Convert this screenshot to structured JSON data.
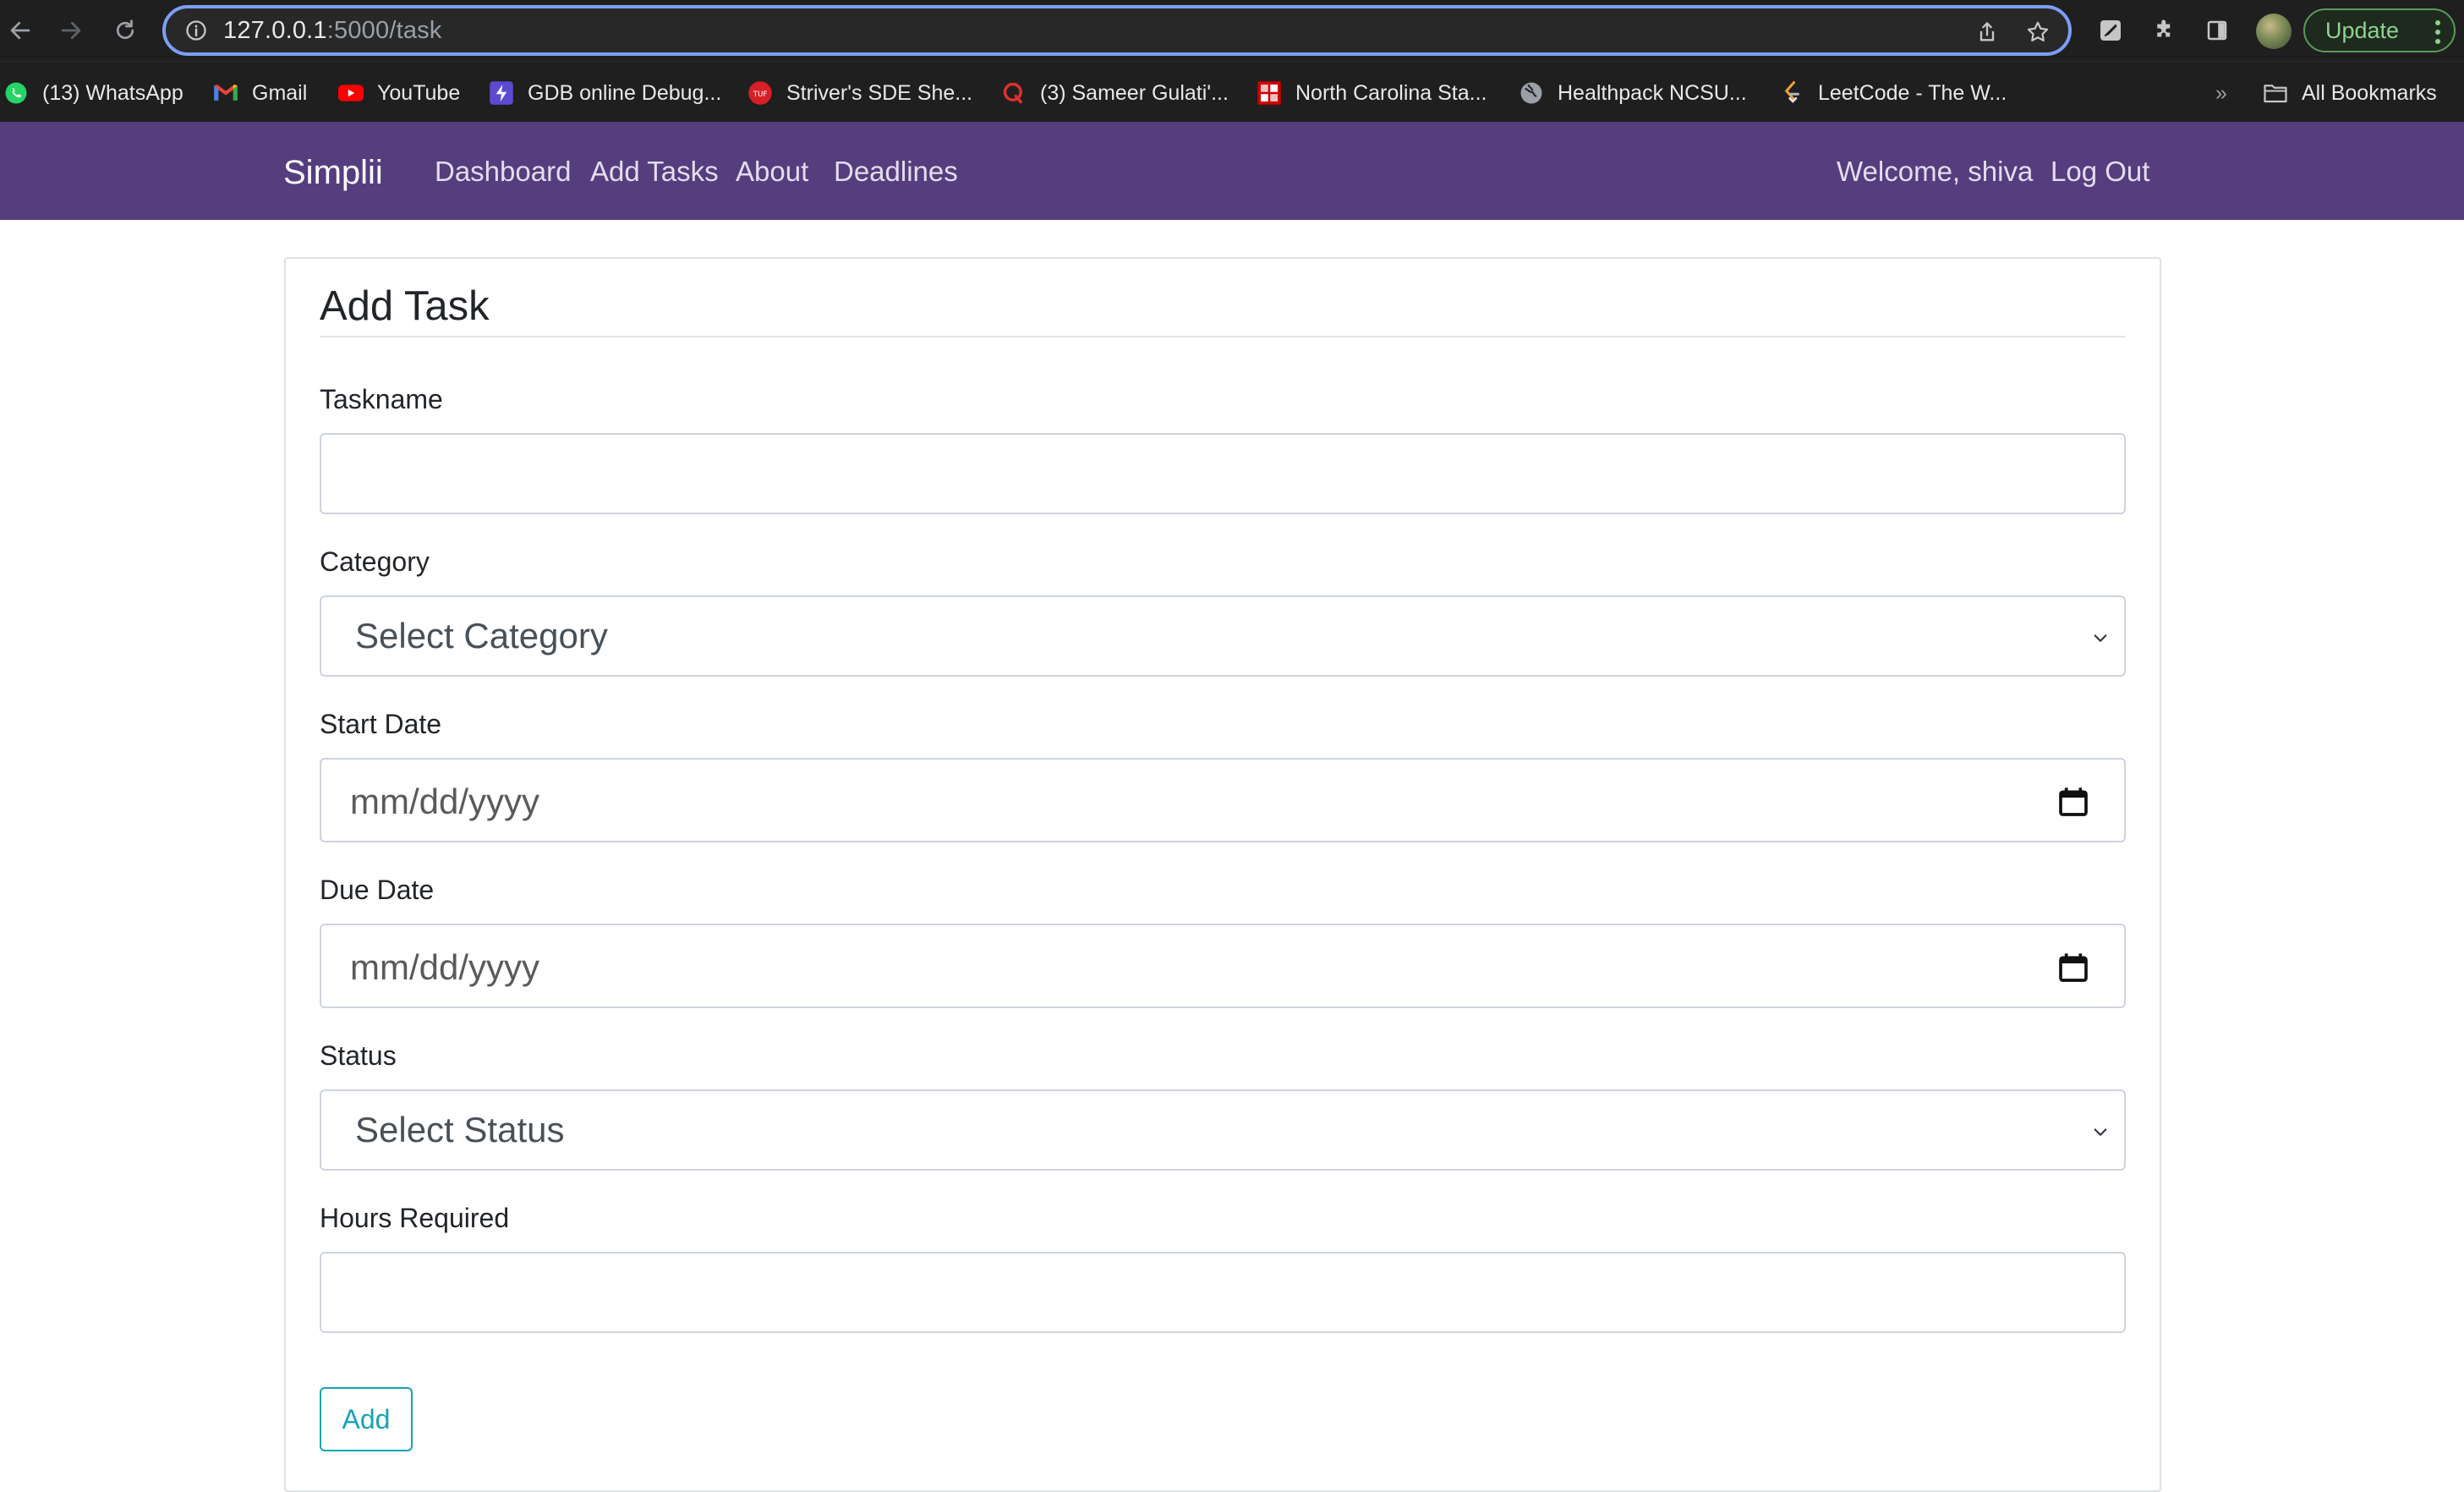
{
  "browser": {
    "url_host": "127.0.0.1",
    "url_rest": ":5000/task",
    "update_label": "Update",
    "bookmarks": [
      {
        "label": "(13) WhatsApp",
        "icon": "whatsapp-icon"
      },
      {
        "label": "Gmail",
        "icon": "gmail-icon"
      },
      {
        "label": "YouTube",
        "icon": "youtube-icon"
      },
      {
        "label": "GDB online Debug...",
        "icon": "gdb-icon"
      },
      {
        "label": "Striver's SDE She...",
        "icon": "tuf-icon"
      },
      {
        "label": "(3) Sameer Gulati'...",
        "icon": "quora-icon"
      },
      {
        "label": "North Carolina Sta...",
        "icon": "ncsu-icon"
      },
      {
        "label": "Healthpack NCSU...",
        "icon": "globe-icon"
      },
      {
        "label": "LeetCode - The W...",
        "icon": "leetcode-icon"
      }
    ],
    "overflow_label": "»",
    "all_bookmarks_label": "All Bookmarks"
  },
  "navbar": {
    "brand": "Simplii",
    "links": [
      "Dashboard",
      "Add Tasks",
      "About",
      "Deadlines"
    ],
    "welcome": "Welcome, shiva",
    "logout": "Log Out",
    "bg_color": "#553d7e"
  },
  "form": {
    "legend": "Add Task",
    "fields": {
      "taskname": {
        "label": "Taskname",
        "value": ""
      },
      "category": {
        "label": "Category",
        "selected": "Select Category"
      },
      "start_date": {
        "label": "Start Date",
        "placeholder": "mm/dd/yyyy"
      },
      "due_date": {
        "label": "Due Date",
        "placeholder": "mm/dd/yyyy"
      },
      "status": {
        "label": "Status",
        "selected": "Select Status"
      },
      "hours": {
        "label": "Hours Required",
        "value": ""
      }
    },
    "submit_label": "Add",
    "submit_color": "#17a2b8"
  }
}
